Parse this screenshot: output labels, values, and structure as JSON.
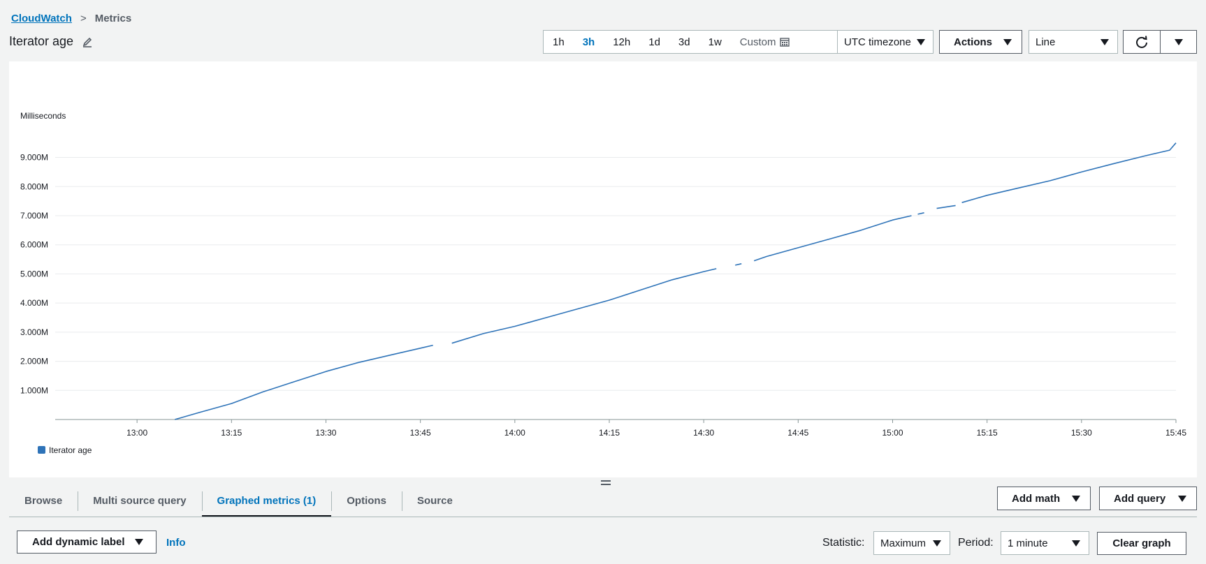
{
  "breadcrumb": {
    "root": "CloudWatch",
    "separator": ">",
    "current": "Metrics"
  },
  "page_title": "Iterator age",
  "time_ranges": [
    "1h",
    "3h",
    "12h",
    "1d",
    "3d",
    "1w"
  ],
  "active_time_range": "3h",
  "custom_label": "Custom",
  "timezone_label": "UTC timezone",
  "actions_label": "Actions",
  "graph_type_label": "Line",
  "colors": {
    "accent": "#0073bb",
    "series": "#2e73b8",
    "grid": "#e9ebed",
    "axis": "#879596"
  },
  "chart_data": {
    "type": "line",
    "ylabel": "Milliseconds",
    "yticks": [
      "1.000M",
      "2.000M",
      "3.000M",
      "4.000M",
      "5.000M",
      "6.000M",
      "7.000M",
      "8.000M",
      "9.000M"
    ],
    "ytick_values": [
      1,
      2,
      3,
      4,
      5,
      6,
      7,
      8,
      9
    ],
    "ylim": [
      0,
      9.9
    ],
    "xticks": [
      "13:00",
      "13:15",
      "13:30",
      "13:45",
      "14:00",
      "14:15",
      "14:30",
      "14:45",
      "15:00",
      "15:15",
      "15:30",
      "15:45"
    ],
    "xtick_values": [
      "13:00",
      "13:15",
      "13:30",
      "13:45",
      "14:00",
      "14:15",
      "14:30",
      "14:45",
      "15:00",
      "15:15",
      "15:30",
      "15:45"
    ],
    "xlim": [
      "12:47",
      "15:45"
    ],
    "grid": true,
    "legend": "bottom-left",
    "series": [
      {
        "name": "Iterator age",
        "segments": [
          {
            "x": [
              "13:06",
              "13:10",
              "13:15",
              "13:20",
              "13:25",
              "13:30",
              "13:35",
              "13:40",
              "13:45",
              "13:47"
            ],
            "y": [
              0.0,
              0.25,
              0.55,
              0.95,
              1.3,
              1.65,
              1.95,
              2.2,
              2.45,
              2.55
            ]
          },
          {
            "x": [
              "13:50",
              "13:55",
              "14:00",
              "14:05",
              "14:10",
              "14:15",
              "14:20",
              "14:25",
              "14:30",
              "14:32"
            ],
            "y": [
              2.62,
              2.95,
              3.2,
              3.5,
              3.8,
              4.1,
              4.45,
              4.8,
              5.08,
              5.18
            ]
          },
          {
            "x": [
              "14:35",
              "14:36"
            ],
            "y": [
              5.3,
              5.35
            ]
          },
          {
            "x": [
              "14:38",
              "14:40",
              "14:45",
              "14:50",
              "14:55",
              "15:00",
              "15:03"
            ],
            "y": [
              5.45,
              5.6,
              5.9,
              6.2,
              6.5,
              6.85,
              7.0
            ]
          },
          {
            "x": [
              "15:04",
              "15:05"
            ],
            "y": [
              7.05,
              7.1
            ]
          },
          {
            "x": [
              "15:07",
              "15:10"
            ],
            "y": [
              7.25,
              7.35
            ]
          },
          {
            "x": [
              "15:11",
              "15:15",
              "15:20",
              "15:25",
              "15:30",
              "15:35",
              "15:40",
              "15:44",
              "15:45"
            ],
            "y": [
              7.45,
              7.7,
              7.95,
              8.2,
              8.5,
              8.78,
              9.05,
              9.25,
              9.5
            ]
          }
        ]
      }
    ]
  },
  "tabs": [
    "Browse",
    "Multi source query",
    "Graphed metrics (1)",
    "Options",
    "Source"
  ],
  "active_tab": "Graphed metrics (1)",
  "add_math_label": "Add math",
  "add_query_label": "Add query",
  "add_dynamic_label": "Add dynamic label",
  "info_label": "Info",
  "statistic": {
    "label": "Statistic:",
    "value": "Maximum"
  },
  "period": {
    "label": "Period:",
    "value": "1 minute"
  },
  "clear_graph_label": "Clear graph"
}
